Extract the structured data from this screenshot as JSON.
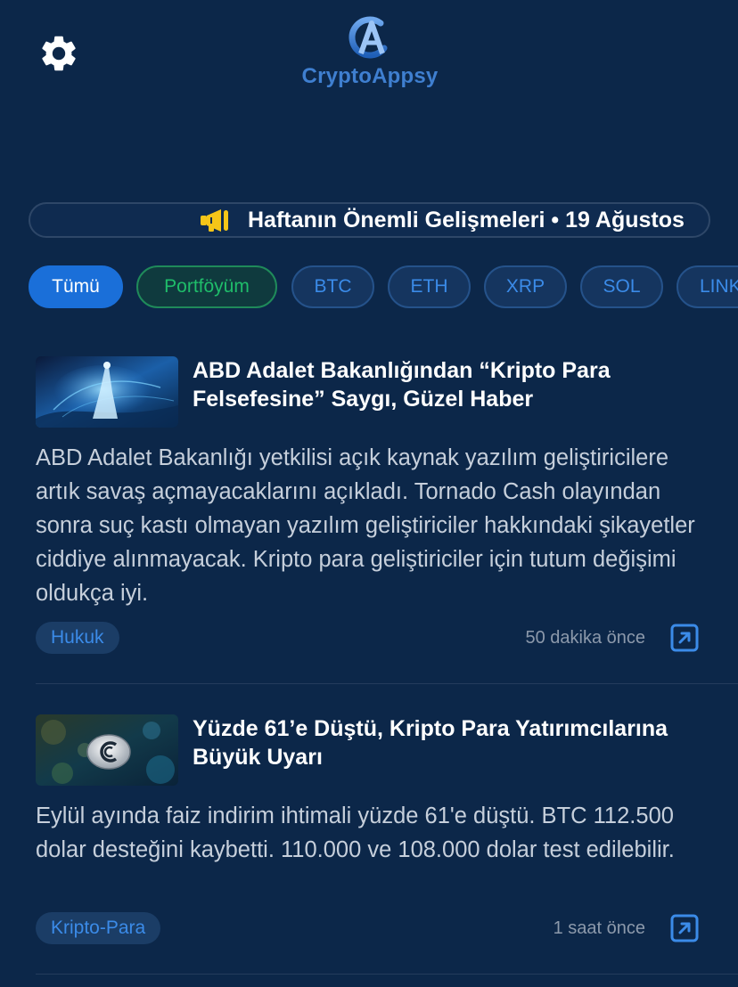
{
  "header": {
    "settings_icon": "gear-icon",
    "logo_text": "CryptoAppsy"
  },
  "ticker": {
    "icon": "megaphone-icon",
    "text": "Haftanın Önemli Gelişmeleri • 19 Ağustos"
  },
  "filters": [
    {
      "label": "Tümü",
      "state": "selected"
    },
    {
      "label": "Portföyüm",
      "state": "portfolio"
    },
    {
      "label": "BTC",
      "state": "default"
    },
    {
      "label": "ETH",
      "state": "default"
    },
    {
      "label": "XRP",
      "state": "default"
    },
    {
      "label": "SOL",
      "state": "default"
    },
    {
      "label": "LINK",
      "state": "default"
    }
  ],
  "news": [
    {
      "title": "ABD Adalet Bakanlığından “Kripto Para Felsefesine” Saygı, Güzel Haber",
      "summary": "ABD Adalet Bakanlığı yetkilisi açık kaynak yazılım geliştiricilere artık savaş açmayacaklarını açıkladı. Tornado Cash olayından sonra suç kastı olmayan yazılım geliştiriciler hakkındaki şikayetler ciddiye alınmayacak. Kripto para geliştiriciler için tutum değişimi oldukça iyi.",
      "tag": "Hukuk",
      "time": "50 dakika önce",
      "link_icon": "external-link-icon"
    },
    {
      "title": "Yüzde 61’e Düştü, Kripto Para Yatırımcılarına Büyük Uyarı",
      "summary": "Eylül ayında faiz indirim ihtimali yüzde 61'e düştü. BTC 112.500 dolar desteğini kaybetti. 110.000 ve 108.000 dolar test edilebilir.",
      "tag": "Kripto-Para",
      "time": "1 saat önce",
      "link_icon": "external-link-icon"
    }
  ],
  "colors": {
    "background": "#0c2749",
    "accent": "#1a6fd9",
    "portfolio": "#1fbd6a",
    "link": "#3b8be8"
  }
}
